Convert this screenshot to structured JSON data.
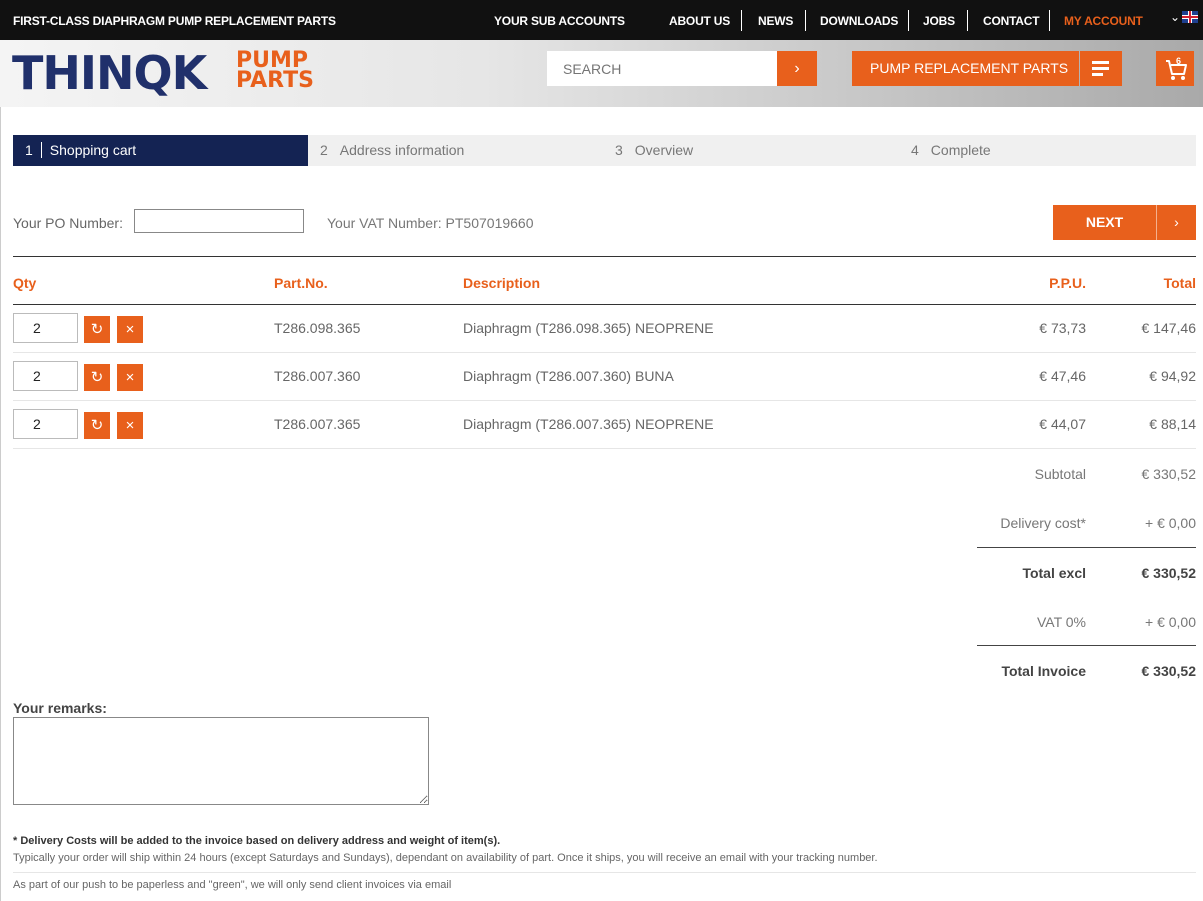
{
  "topbar": {
    "tagline": "FIRST-CLASS DIAPHRAGM PUMP REPLACEMENT PARTS",
    "links": [
      "YOUR SUB ACCOUNTS",
      "ABOUT US",
      "NEWS",
      "DOWNLOADS",
      "JOBS",
      "CONTACT"
    ],
    "my_account": "MY ACCOUNT",
    "lang_chevron": "⌄"
  },
  "header": {
    "logo_main": "THINQK",
    "logo_pump": "PUMP",
    "logo_parts": "PARTS",
    "search_placeholder": "SEARCH",
    "search_arrow": "›",
    "parts_button": "PUMP REPLACEMENT PARTS",
    "cart_count": "6"
  },
  "steps": [
    {
      "num": "1",
      "label": "Shopping cart"
    },
    {
      "num": "2",
      "label": "Address information"
    },
    {
      "num": "3",
      "label": "Overview"
    },
    {
      "num": "4",
      "label": "Complete"
    }
  ],
  "order": {
    "po_label": "Your PO Number:",
    "po_value": "",
    "vat_label": "Your VAT Number: PT507019660",
    "next_label": "NEXT",
    "next_arrow": "›"
  },
  "table": {
    "headers": {
      "qty": "Qty",
      "part": "Part.No.",
      "desc": "Description",
      "ppu": "P.P.U.",
      "total": "Total"
    },
    "rows": [
      {
        "qty": "2",
        "part": "T286.098.365",
        "desc": "Diaphragm (T286.098.365) NEOPRENE",
        "ppu": "€ 73,73",
        "total": "€ 147,46"
      },
      {
        "qty": "2",
        "part": "T286.007.360",
        "desc": "Diaphragm (T286.007.360) BUNA",
        "ppu": "€ 47,46",
        "total": "€ 94,92"
      },
      {
        "qty": "2",
        "part": "T286.007.365",
        "desc": "Diaphragm (T286.007.365) NEOPRENE",
        "ppu": "€ 44,07",
        "total": "€ 88,14"
      }
    ],
    "refresh_icon": "↻",
    "delete_icon": "×"
  },
  "totals": {
    "subtotal_label": "Subtotal",
    "subtotal": "€ 330,52",
    "delivery_label": "Delivery cost*",
    "delivery": "+ € 0,00",
    "excl_label": "Total excl",
    "excl": "€ 330,52",
    "vat_label": "VAT 0%",
    "vat": "+ € 0,00",
    "invoice_label": "Total Invoice",
    "invoice": "€ 330,52"
  },
  "remarks": {
    "label": "Your remarks:",
    "value": ""
  },
  "notes": {
    "delivery_bold": "* Delivery Costs will be added to the invoice based on delivery address and weight of item(s).",
    "shipping": "Typically your order will ship within 24 hours (except Saturdays and Sundays), dependant on availability of part. Once it ships, you will receive an email with your tracking number.",
    "paperless": "As part of our push to be paperless and \"green\", we will only send client invoices via email"
  },
  "colors": {
    "accent": "#e8601c",
    "navy": "#142353",
    "logo_navy": "#20306b"
  }
}
